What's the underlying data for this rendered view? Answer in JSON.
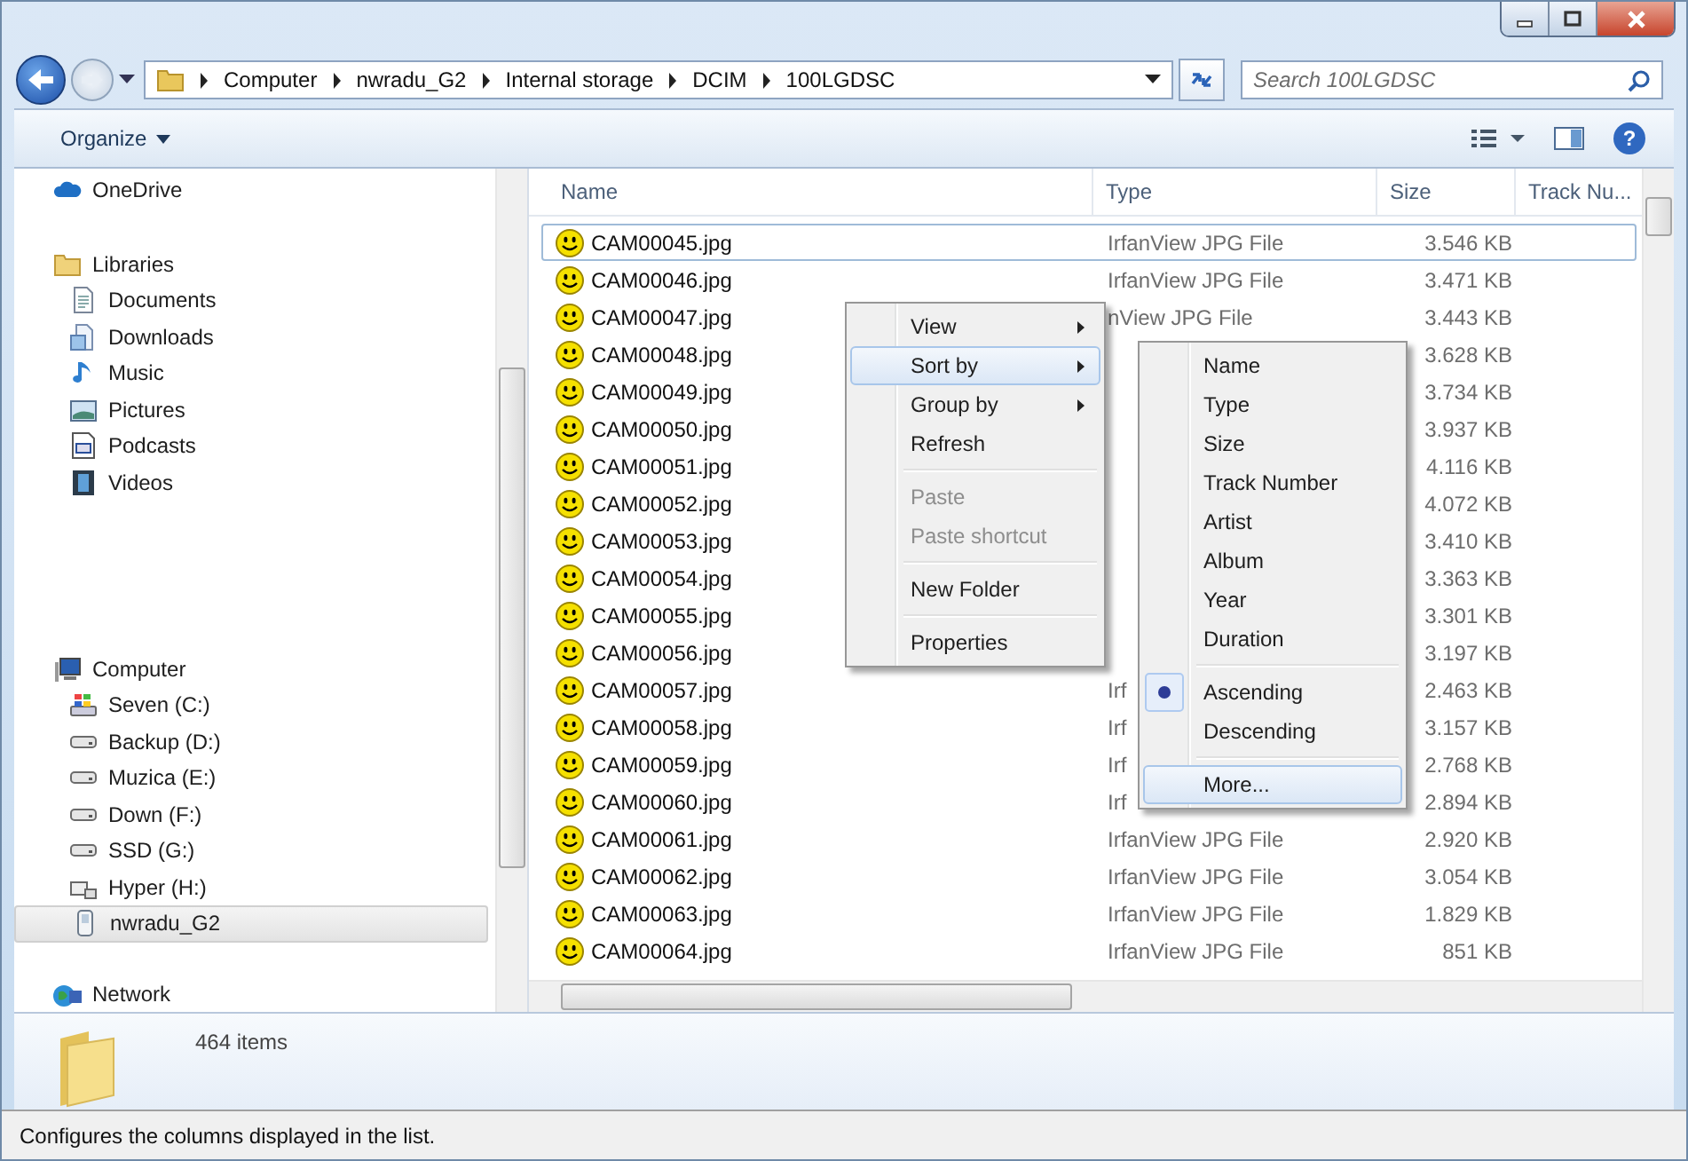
{
  "address_bar": {
    "crumbs": [
      "Computer",
      "nwradu_G2",
      "Internal storage",
      "DCIM",
      "100LGDSC"
    ]
  },
  "search": {
    "placeholder": "Search 100LGDSC"
  },
  "toolbar": {
    "organize": "Organize",
    "help": "?"
  },
  "sidebar": {
    "items": [
      {
        "label": "OneDrive",
        "kind": "cloud",
        "selected": false
      },
      {
        "label": "Libraries",
        "kind": "library",
        "selected": false,
        "children": [
          {
            "label": "Documents",
            "kind": "document",
            "selected": false
          },
          {
            "label": "Downloads",
            "kind": "download",
            "selected": false
          },
          {
            "label": "Music",
            "kind": "music",
            "selected": false
          },
          {
            "label": "Pictures",
            "kind": "pictures",
            "selected": false
          },
          {
            "label": "Podcasts",
            "kind": "podcasts",
            "selected": false
          },
          {
            "label": "Videos",
            "kind": "videos",
            "selected": false
          }
        ]
      },
      {
        "label": "Computer",
        "kind": "computer",
        "selected": false,
        "children": [
          {
            "label": "Seven (C:)",
            "kind": "system-drive",
            "selected": false
          },
          {
            "label": "Backup (D:)",
            "kind": "drive",
            "selected": false
          },
          {
            "label": "Muzica (E:)",
            "kind": "drive",
            "selected": false
          },
          {
            "label": "Down (F:)",
            "kind": "drive",
            "selected": false
          },
          {
            "label": "SSD (G:)",
            "kind": "drive",
            "selected": false
          },
          {
            "label": "Hyper (H:)",
            "kind": "network-drive",
            "selected": false
          },
          {
            "label": "nwradu_G2",
            "kind": "phone",
            "selected": true
          }
        ]
      },
      {
        "label": "Network",
        "kind": "network",
        "selected": false
      }
    ]
  },
  "table": {
    "columns": [
      "Name",
      "Type",
      "Size",
      "Track Nu..."
    ],
    "rows": [
      {
        "name": "CAM00045.jpg",
        "type": "IrfanView JPG File",
        "size": "3.546 KB",
        "focused": true
      },
      {
        "name": "CAM00046.jpg",
        "type": "IrfanView JPG File",
        "size": "3.471 KB",
        "focused": false
      },
      {
        "name": "CAM00047.jpg",
        "type": "nView JPG File",
        "size": "3.443 KB",
        "focused": false
      },
      {
        "name": "CAM00048.jpg",
        "size": "3.628 KB",
        "focused": false
      },
      {
        "name": "CAM00049.jpg",
        "size": "3.734 KB",
        "focused": false
      },
      {
        "name": "CAM00050.jpg",
        "size": "3.937 KB",
        "focused": false
      },
      {
        "name": "CAM00051.jpg",
        "size": "4.116 KB",
        "focused": false
      },
      {
        "name": "CAM00052.jpg",
        "size": "4.072 KB",
        "focused": false
      },
      {
        "name": "CAM00053.jpg",
        "size": "3.410 KB",
        "focused": false
      },
      {
        "name": "CAM00054.jpg",
        "size": "3.363 KB",
        "focused": false
      },
      {
        "name": "CAM00055.jpg",
        "size": "3.301 KB",
        "focused": false
      },
      {
        "name": "CAM00056.jpg",
        "size": "3.197 KB",
        "focused": false
      },
      {
        "name": "CAM00057.jpg",
        "type": "Irf",
        "size": "2.463 KB",
        "focused": false
      },
      {
        "name": "CAM00058.jpg",
        "type": "Irf",
        "size": "3.157 KB",
        "focused": false
      },
      {
        "name": "CAM00059.jpg",
        "type": "Irf",
        "size": "2.768 KB",
        "focused": false
      },
      {
        "name": "CAM00060.jpg",
        "type": "Irf",
        "size": "2.894 KB",
        "focused": false
      },
      {
        "name": "CAM00061.jpg",
        "type": "IrfanView JPG File",
        "size": "2.920 KB",
        "focused": false
      },
      {
        "name": "CAM00062.jpg",
        "type": "IrfanView JPG File",
        "size": "3.054 KB",
        "focused": false
      },
      {
        "name": "CAM00063.jpg",
        "type": "IrfanView JPG File",
        "size": "1.829 KB",
        "focused": false
      },
      {
        "name": "CAM00064.jpg",
        "type": "IrfanView JPG File",
        "size": "851 KB",
        "focused": false
      }
    ]
  },
  "context_menu": {
    "items": [
      {
        "kind": "item",
        "label": "View",
        "submenu": true,
        "highlighted": false,
        "disabled": false
      },
      {
        "kind": "item",
        "label": "Sort by",
        "submenu": true,
        "highlighted": true,
        "disabled": false
      },
      {
        "kind": "item",
        "label": "Group by",
        "submenu": true,
        "highlighted": false,
        "disabled": false
      },
      {
        "kind": "item",
        "label": "Refresh",
        "submenu": false,
        "highlighted": false,
        "disabled": false
      },
      {
        "kind": "separator"
      },
      {
        "kind": "item",
        "label": "Paste",
        "submenu": false,
        "highlighted": false,
        "disabled": true
      },
      {
        "kind": "item",
        "label": "Paste shortcut",
        "submenu": false,
        "highlighted": false,
        "disabled": true
      },
      {
        "kind": "separator"
      },
      {
        "kind": "item",
        "label": "New Folder",
        "submenu": false,
        "highlighted": false,
        "disabled": false
      },
      {
        "kind": "separator"
      },
      {
        "kind": "item",
        "label": "Properties",
        "submenu": false,
        "highlighted": false,
        "disabled": false
      }
    ]
  },
  "sort_submenu": {
    "items": [
      {
        "kind": "item",
        "label": "Name",
        "checked": false,
        "highlighted": false
      },
      {
        "kind": "item",
        "label": "Type",
        "checked": false,
        "highlighted": false
      },
      {
        "kind": "item",
        "label": "Size",
        "checked": false,
        "highlighted": false
      },
      {
        "kind": "item",
        "label": "Track Number",
        "checked": false,
        "highlighted": false
      },
      {
        "kind": "item",
        "label": "Artist",
        "checked": false,
        "highlighted": false
      },
      {
        "kind": "item",
        "label": "Album",
        "checked": false,
        "highlighted": false
      },
      {
        "kind": "item",
        "label": "Year",
        "checked": false,
        "highlighted": false
      },
      {
        "kind": "item",
        "label": "Duration",
        "checked": false,
        "highlighted": false
      },
      {
        "kind": "separator"
      },
      {
        "kind": "item",
        "label": "Ascending",
        "checked": true,
        "highlighted": false
      },
      {
        "kind": "item",
        "label": "Descending",
        "checked": false,
        "highlighted": false
      },
      {
        "kind": "separator"
      },
      {
        "kind": "item",
        "label": "More...",
        "checked": false,
        "highlighted": true
      }
    ]
  },
  "details_pane": {
    "count": "464 items"
  },
  "status_bar": {
    "text": "Configures the columns displayed in the list."
  }
}
